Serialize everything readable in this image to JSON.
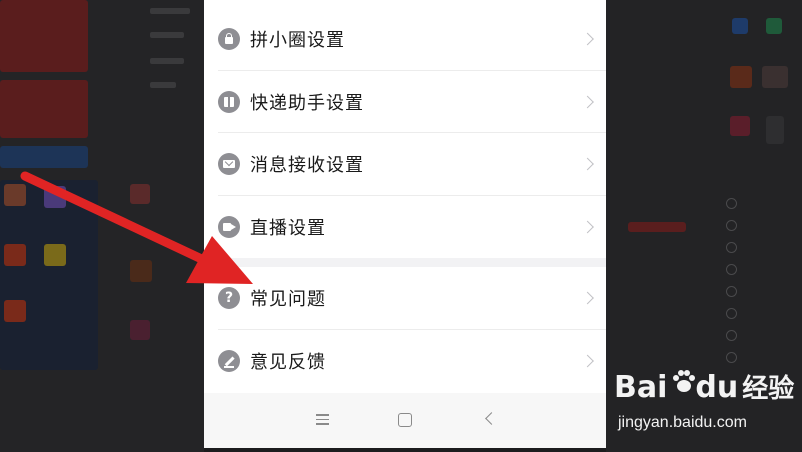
{
  "settings_list": {
    "items": [
      {
        "label": "拼小圈设置",
        "icon": "lock-icon"
      },
      {
        "label": "快递助手设置",
        "icon": "package-icon"
      },
      {
        "label": "消息接收设置",
        "icon": "message-icon"
      },
      {
        "label": "直播设置",
        "icon": "live-camera-icon"
      },
      {
        "label": "常见问题",
        "icon": "question-icon"
      },
      {
        "label": "意见反馈",
        "icon": "feedback-pen-icon"
      }
    ],
    "question_glyph": "?"
  },
  "navbar": {
    "icons": [
      "menu-icon",
      "home-icon",
      "back-icon"
    ]
  },
  "watermark": {
    "logo_left": "Bai",
    "logo_right": "du",
    "logo_cn": "经验",
    "url": "jingyan.baidu.com"
  },
  "colors": {
    "arrow": "#e02424",
    "icon_gray": "#8e8e93",
    "overlay_dark": "#1c1c1e"
  }
}
